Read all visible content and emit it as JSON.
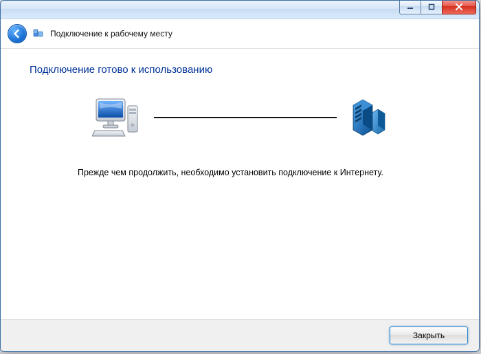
{
  "header": {
    "title": "Подключение к рабочему месту"
  },
  "content": {
    "heading": "Подключение готово к использованию",
    "message": "Прежде чем продолжить, необходимо установить подключение к Интернету."
  },
  "footer": {
    "close_label": "Закрыть"
  },
  "icons": {
    "back": "back-arrow",
    "app": "network-place",
    "pc": "computer",
    "server": "server"
  }
}
